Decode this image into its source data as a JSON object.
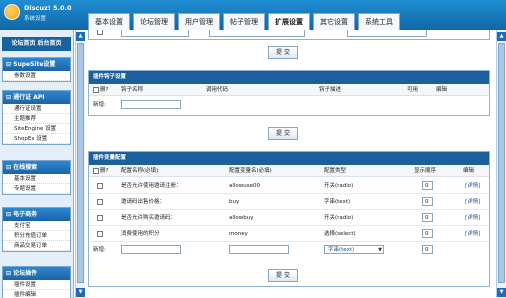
{
  "app": {
    "title": "Discuz! 5.0.0",
    "subtitle": "系统设置"
  },
  "tabs": [
    "基本设置",
    "论坛管理",
    "用户管理",
    "帖子管理",
    "扩展设置",
    "其它设置",
    "系统工具"
  ],
  "sidebar": {
    "top": "论坛首页 后台首页",
    "menus": [
      {
        "title": "SupeSite设置",
        "items": [
          "参数设置"
        ]
      },
      {
        "title": "通行证 API",
        "items": [
          "通行证设置",
          "主题推荐",
          "SiteEngine 设置",
          "ShopEx 设置"
        ]
      },
      {
        "title": "在线搜索",
        "items": [
          "基本设置",
          "专题设置"
        ]
      },
      {
        "title": "电子商务",
        "items": [
          "支付宝",
          "积分充值订单",
          "商品交易订单"
        ]
      },
      {
        "title": "论坛插件",
        "items": [
          "插件设置",
          "插件编辑"
        ]
      }
    ]
  },
  "hooks": {
    "title": "插件钩子设置",
    "columns": [
      "删?",
      "钩子名称",
      "调用代码",
      "钩子描述",
      "可用",
      "编辑"
    ],
    "new_label": "新增:"
  },
  "vars": {
    "title": "插件变量配置",
    "columns": [
      "删?",
      "配置名称(必填)",
      "配置变量名(必填)",
      "配置类型",
      "显示顺序",
      "编辑"
    ],
    "rows": [
      {
        "name": "是否允许使用邀请注册：",
        "var": "allowuse00",
        "type": "开关(radio)",
        "order": "0",
        "edit": "[详情]"
      },
      {
        "name": "邀请码出售价格：",
        "var": "buy",
        "type": "字串(text)",
        "order": "0",
        "edit": "[详情]"
      },
      {
        "name": "是否允许购买邀请码：",
        "var": "allowbuy",
        "type": "开关(radio)",
        "order": "0",
        "edit": "[详情]"
      },
      {
        "name": "消费使用的积分",
        "var": "money",
        "type": "选择(select)",
        "order": "0",
        "edit": "[详情]"
      }
    ],
    "new_label": "新增:",
    "new_type": "字串(text)",
    "new_order": "0"
  },
  "submit_label": "提 交"
}
